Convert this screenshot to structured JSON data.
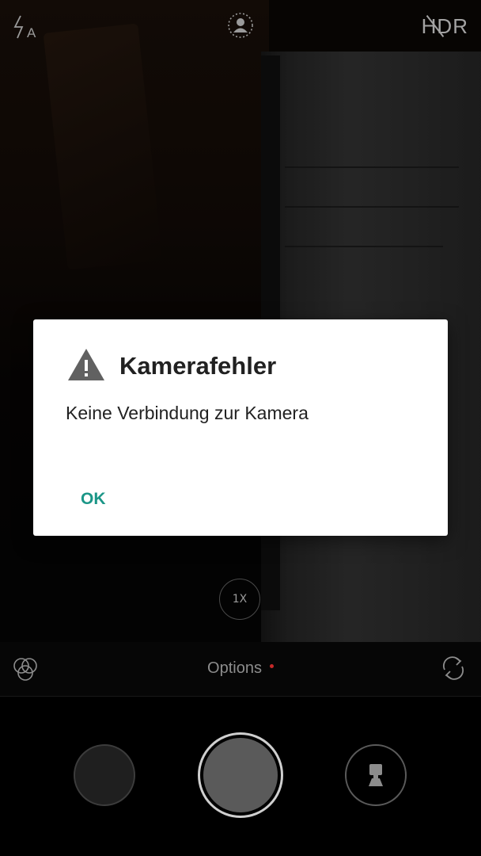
{
  "camera": {
    "top_bar": {
      "flash_icon": "flash-auto-icon",
      "portrait_icon": "portrait-mode-icon",
      "hdr_label": "HDR"
    },
    "zoom_label": "1X",
    "options": {
      "label": "Options",
      "indicator_color": "#c62828",
      "filters_icon": "filters-icon",
      "switch_camera_icon": "switch-camera-icon"
    },
    "controls": {
      "gallery_icon": "gallery-thumbnail",
      "shutter_icon": "shutter-button",
      "mode_icon": "camera-mode-icon"
    }
  },
  "dialog": {
    "icon": "warning-icon",
    "title": "Kamerafehler",
    "message": "Keine Verbindung zur Kamera",
    "ok_label": "OK",
    "accent_color": "#1b9687"
  }
}
